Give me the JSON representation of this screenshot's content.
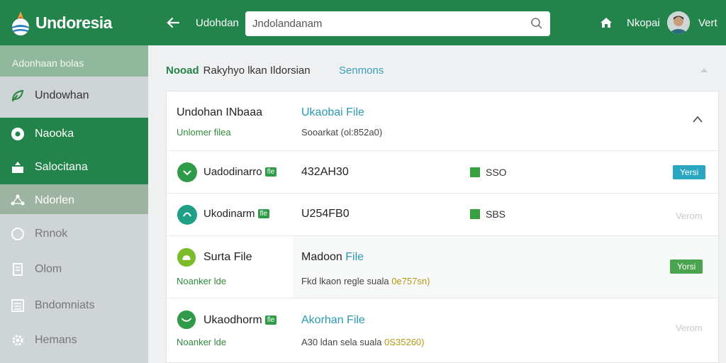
{
  "app": {
    "title": "Undoresia"
  },
  "header": {
    "breadcrumb": "Udohdan",
    "search_value": "Jndolandanam",
    "user_label": "Nkopai",
    "user_short": "Vert"
  },
  "sidebar": {
    "heading": "Adonhaan bolas",
    "items": [
      {
        "label": "Undowhan",
        "icon": "leaf-icon"
      },
      {
        "label": "Naooka",
        "icon": "gear-icon"
      },
      {
        "label": "Salocitana",
        "icon": "upload-icon"
      },
      {
        "label": "Ndorlen",
        "icon": "network-icon"
      },
      {
        "label": "Rnnok",
        "icon": "circle-icon"
      },
      {
        "label": "Olom",
        "icon": "document-icon"
      },
      {
        "label": "Bndomniats",
        "icon": "list-icon"
      },
      {
        "label": "Hemans",
        "icon": "settings-icon"
      }
    ],
    "active_index": 1
  },
  "section": {
    "title_green": "Nooad",
    "title_text": "Rakyhyo lkan Ildorsian",
    "link": "Senmons"
  },
  "rows": [
    {
      "name": "Undohan INbaaa",
      "sub": "Unlomer filea",
      "file_key": "Ukaobai File",
      "file_sub": "Sooarkat (ol:852a0)"
    },
    {
      "name": "Uadodinarro",
      "tag": "fle",
      "code": "432AH30",
      "value": "SSO",
      "action": "Yersi"
    },
    {
      "name": "Ukodinarm",
      "tag": "fle",
      "code": "U254FB0",
      "value": "SBS",
      "action": "Verom"
    },
    {
      "name": "Surta File",
      "sub": "Noanker lde",
      "file_key": "Madoon",
      "file_word": "File",
      "file_sub": "Fkd lkaon regle suala",
      "file_code": "0e757sn)",
      "action": "Yorsi"
    },
    {
      "name": "Ukaodhorm",
      "tag": "fle",
      "sub": "Noanker lde",
      "file_key": "Akorhan",
      "file_word": "File",
      "file_sub": "A30 ldan sela suala",
      "file_code": "0S35260)",
      "action": "Verom"
    }
  ],
  "colors": {
    "primary": "#22844a",
    "accent": "#3aa0b8",
    "sidebar_active": "#22844a"
  }
}
